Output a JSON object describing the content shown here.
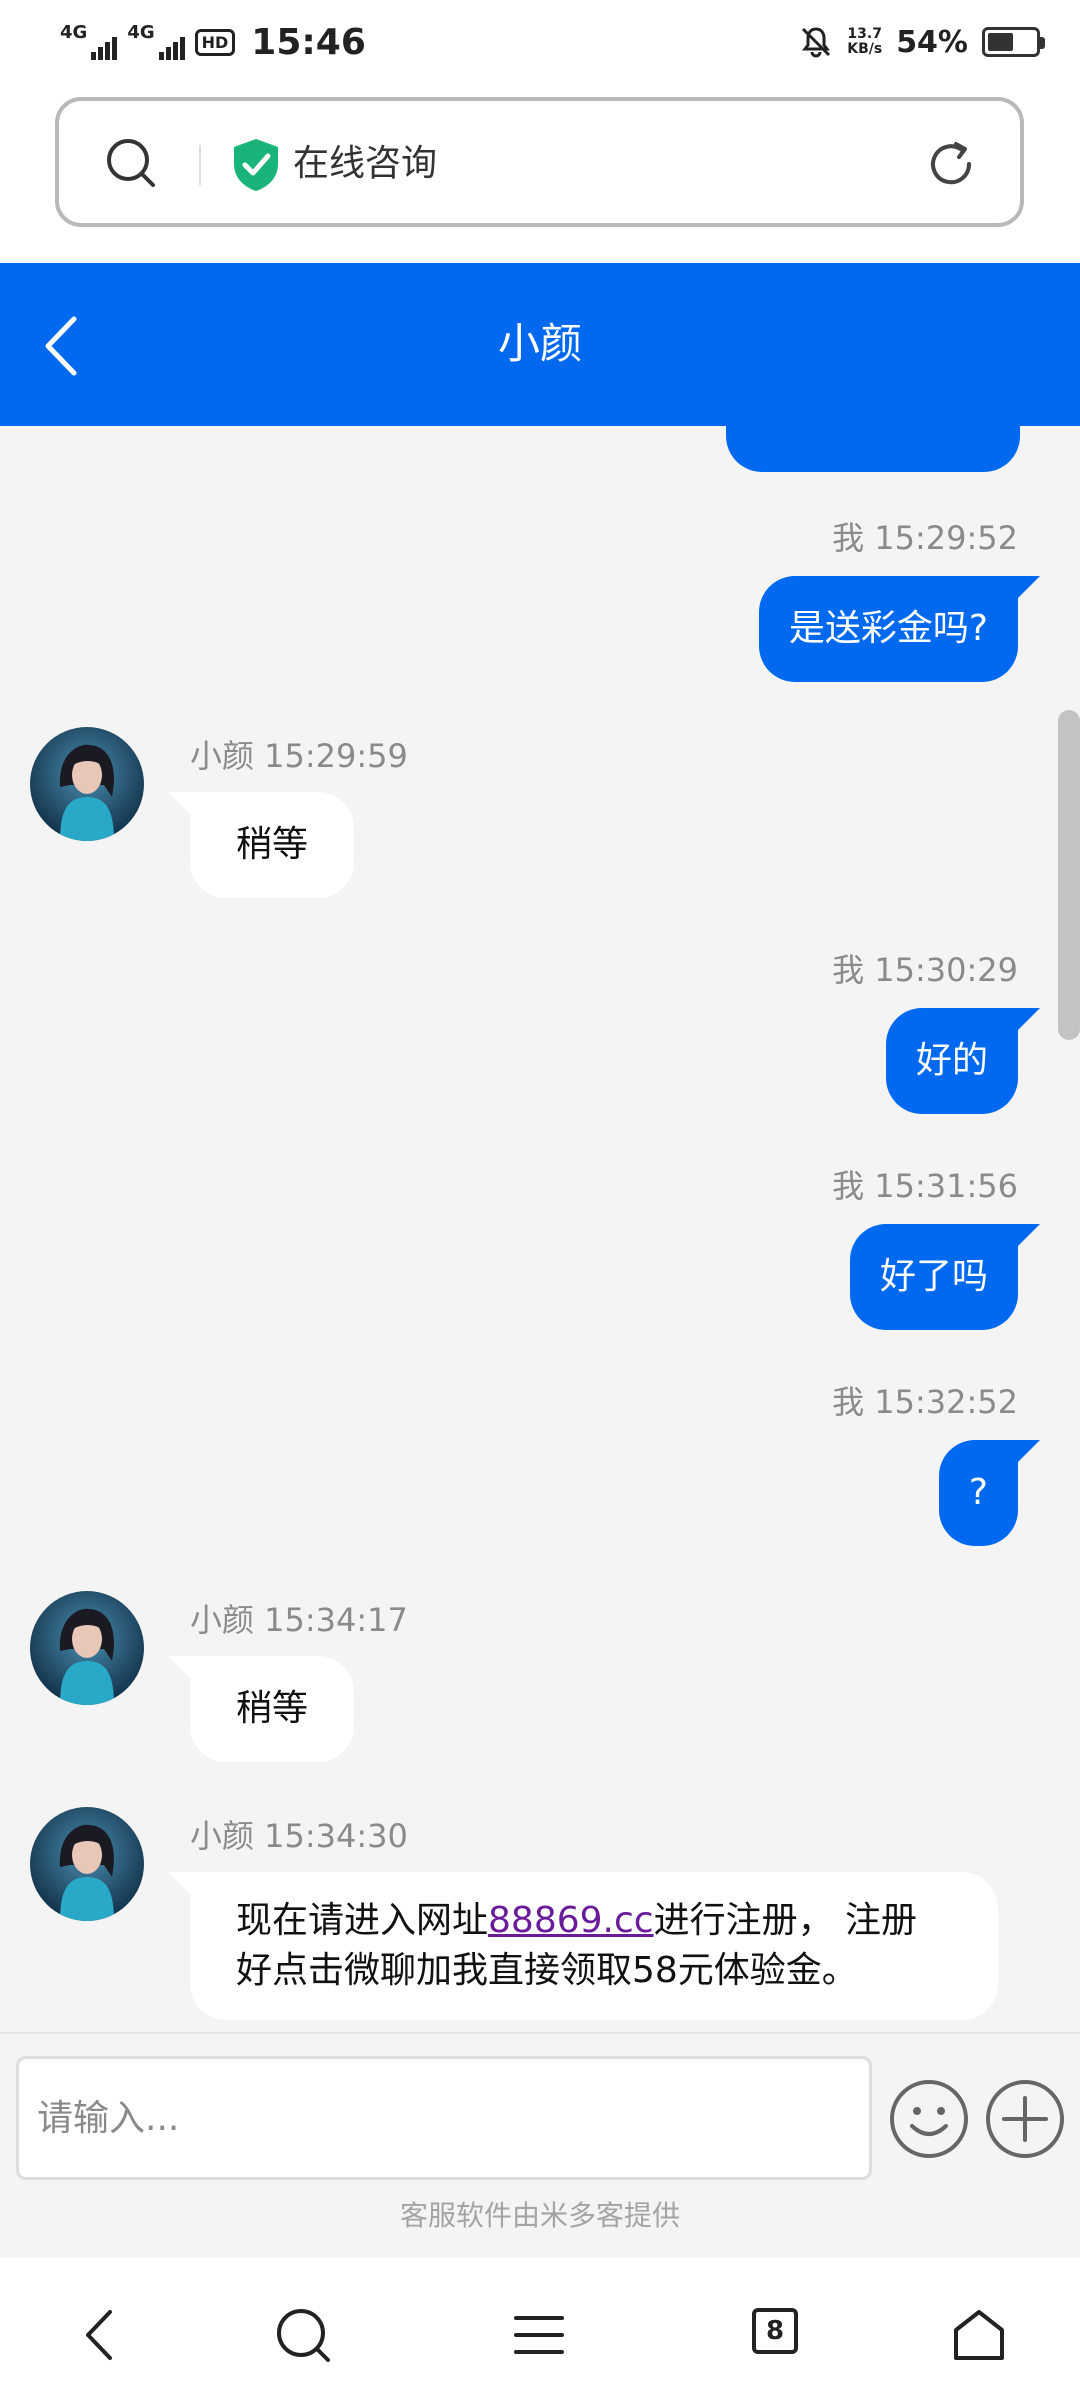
{
  "status_bar": {
    "time": "15:46",
    "network_1": "4G",
    "network_2": "4G",
    "hd_label": "HD",
    "net_speed_value": "13.7",
    "net_speed_unit": "KB/s",
    "battery_percent": "54%",
    "battery_level": 0.54
  },
  "browser": {
    "url_title": "在线咨询",
    "tab_count": "8"
  },
  "chat": {
    "title": "小颜",
    "messages": [
      {
        "from": "me",
        "meta": "我 15:29:52",
        "text": "是送彩金吗?"
      },
      {
        "from": "agent",
        "meta": "小颜 15:29:59",
        "text": "稍等"
      },
      {
        "from": "me",
        "meta": "我 15:30:29",
        "text": "好的"
      },
      {
        "from": "me",
        "meta": "我 15:31:56",
        "text": "好了吗"
      },
      {
        "from": "me",
        "meta": "我 15:32:52",
        "text": "?"
      },
      {
        "from": "agent",
        "meta": "小颜 15:34:17",
        "text": "稍等"
      },
      {
        "from": "agent",
        "meta": "小颜 15:34:30",
        "text_before_link": "现在请进入网址",
        "link": "88869.cc",
        "text_after_link": "进行注册， 注册好点击微聊加我直接领取58元体验金。"
      }
    ],
    "input_placeholder": "请输入...",
    "powered_by": "客服软件由米多客提供"
  },
  "colors": {
    "accent": "#0069f0",
    "chat_background": "#f4f4f4",
    "link": "#6a1b9a"
  },
  "icons": {
    "url_bar": [
      "search-icon",
      "shield-check-icon",
      "reload-icon"
    ],
    "header": [
      "back-icon"
    ],
    "input": [
      "emoji-icon",
      "plus-icon"
    ],
    "nav": [
      "back-icon",
      "search-icon",
      "menu-icon",
      "tabs-icon",
      "home-icon"
    ]
  }
}
